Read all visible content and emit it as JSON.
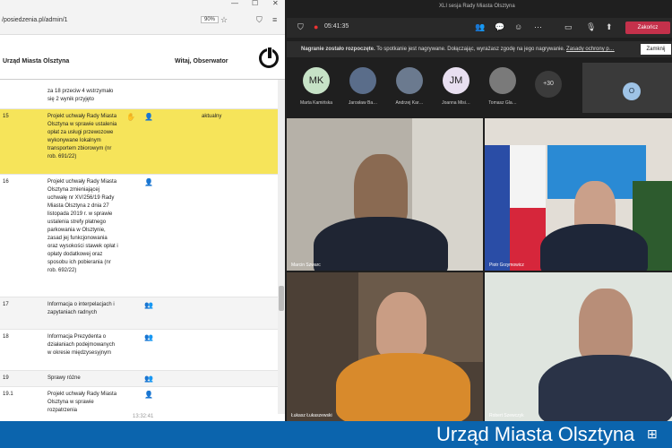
{
  "browser": {
    "url": "/posiedzenia.pl/admin/1",
    "zoom": "90%"
  },
  "app": {
    "org": "Urząd Miasta Olsztyna",
    "greeting": "Witaj, Obserwator"
  },
  "agenda": [
    {
      "num": "",
      "text": "za 18 przeciw 4 wstrzymało się 2 wynik przyjęto",
      "highlight": false,
      "status": ""
    },
    {
      "num": "15",
      "text": "Projekt uchwały Rady Miasta Olsztyna w sprawie ustalenia opłat za usługi przewozowe wykonywane lokalnym transportem zbiorowym (nr rob. 691/22)",
      "highlight": true,
      "status": "aktualny"
    },
    {
      "num": "16",
      "text": "Projekt uchwały Rady Miasta Olsztyna zmieniającej uchwałę nr XV/256/19 Rady Miasta Olsztyna z dnia 27 listopada 2019 r. w sprawie ustalenia strefy płatnego parkowania w Olsztynie, zasad jej funkcjonowania oraz wysokości stawek opłat i opłaty dodatkowej oraz sposobu ich pobierania (nr rob. 692/22)",
      "highlight": false,
      "status": ""
    },
    {
      "num": "17",
      "text": "Informacja o interpelacjach i zapytaniach radnych",
      "highlight": false,
      "status": ""
    },
    {
      "num": "18",
      "text": "Informacja Prezydenta o działaniach podejmowanych w okresie międzysesyjnym",
      "highlight": false,
      "status": ""
    },
    {
      "num": "19",
      "text": "Sprawy różne",
      "highlight": false,
      "status": ""
    },
    {
      "num": "19.1",
      "text": "Projekt uchwały Rady Miasta Olsztyna w sprawie rozpatrzenia",
      "highlight": false,
      "status": ""
    }
  ],
  "footer_time": "13:32:41",
  "teams": {
    "window_title": "XLI sesja Rady Miasta Olsztyna",
    "timer": "05:41:35",
    "end_label": "Zakończ",
    "notice_bold": "Nagranie zostało rozpoczęte.",
    "notice_text": "To spotkanie jest nagrywane. Dołączając, wyrażasz zgodę na jego nagrywanie.",
    "notice_link": "Zasady ochrony p…",
    "notice_close": "Zamknij",
    "participants": [
      {
        "initials": "MK",
        "name": "Marta Kamińska",
        "color": "#c6e2c6"
      },
      {
        "initials": "",
        "name": "Jarosław Ba…",
        "color": "#5a6d8a"
      },
      {
        "initials": "",
        "name": "Andrzej Kar…",
        "color": "#6b7a8f"
      },
      {
        "initials": "JM",
        "name": "Joanna Misi…",
        "color": "#e8dff0"
      },
      {
        "initials": "",
        "name": "Tomasz Gla…",
        "color": "#7a7a7a"
      }
    ],
    "more": "+30",
    "self_initial": "O",
    "tiles": [
      {
        "name": "Marcin Szwarc"
      },
      {
        "name": "Piotr Grzymowicz"
      },
      {
        "name": "Łukasz Łukaszewski"
      },
      {
        "name": "Robert Szewczyk"
      }
    ]
  },
  "banner": "Urząd Miasta Olsztyna"
}
